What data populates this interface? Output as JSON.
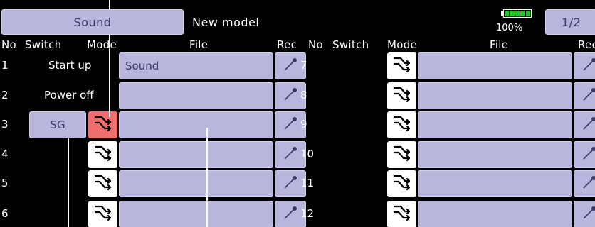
{
  "header": {
    "tab_label": "Sound",
    "title": "New model",
    "battery_percent": "100%",
    "battery_level": 1.0,
    "page": "1/2"
  },
  "columns": {
    "no": "No",
    "switch": "Switch",
    "mode": "Mode",
    "file": "File",
    "rec": "Rec"
  },
  "rows_left": [
    {
      "no": "1",
      "switch": "Start up",
      "file": "Sound"
    },
    {
      "no": "2",
      "switch": "Power off",
      "file": ""
    },
    {
      "no": "3",
      "switch": "SG",
      "file": ""
    },
    {
      "no": "4",
      "switch": "",
      "file": ""
    },
    {
      "no": "5",
      "switch": "",
      "file": ""
    },
    {
      "no": "6",
      "switch": "",
      "file": ""
    }
  ],
  "rows_right": [
    {
      "no": "7",
      "switch": "",
      "file": ""
    },
    {
      "no": "8",
      "switch": "",
      "file": ""
    },
    {
      "no": "9",
      "switch": "",
      "file": ""
    },
    {
      "no": "10",
      "switch": "",
      "file": ""
    },
    {
      "no": "11",
      "switch": "",
      "file": ""
    },
    {
      "no": "12",
      "switch": "",
      "file": ""
    }
  ],
  "icons": {
    "mode": "mode-arrows-icon",
    "rec": "microphone-icon",
    "battery": "battery-icon"
  },
  "colors": {
    "background": "#000000",
    "button": "#b9b6dd",
    "button_text": "#3a3865",
    "mode_selected": "#f06e6e",
    "battery": "#22c322"
  }
}
